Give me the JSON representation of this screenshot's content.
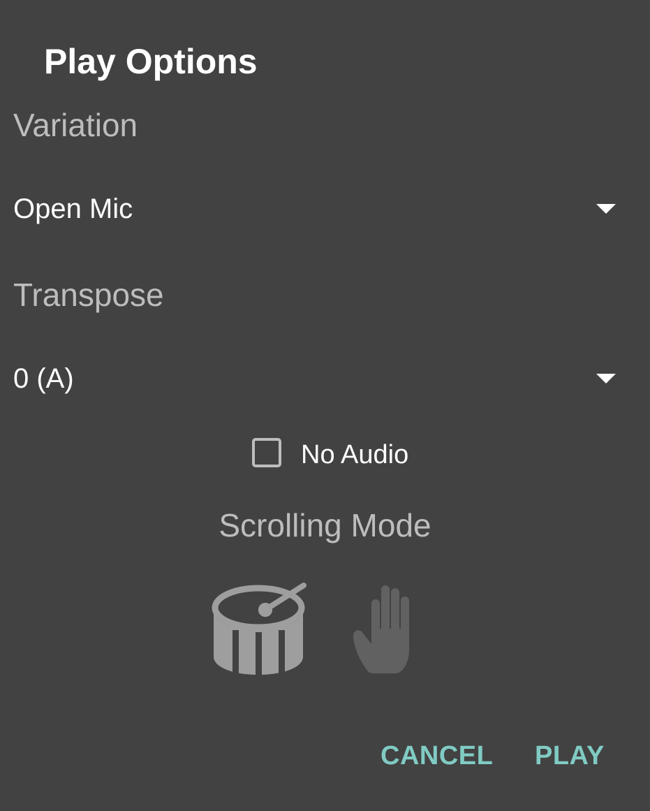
{
  "dialog": {
    "title": "Play Options"
  },
  "variation": {
    "label": "Variation",
    "selected": "Open Mic"
  },
  "transpose": {
    "label": "Transpose",
    "selected": "0 (A)"
  },
  "no_audio": {
    "label": "No Audio",
    "checked": false
  },
  "scrolling_mode": {
    "label": "Scrolling Mode",
    "options": [
      {
        "icon": "drum-icon",
        "state": "selected"
      },
      {
        "icon": "hand-icon",
        "state": "unselected"
      }
    ]
  },
  "buttons": {
    "cancel": "CANCEL",
    "play": "PLAY"
  },
  "colors": {
    "background": "#424242",
    "accent": "#80cbc4",
    "secondary_text": "#bdbdbd",
    "primary_text": "#ffffff"
  }
}
